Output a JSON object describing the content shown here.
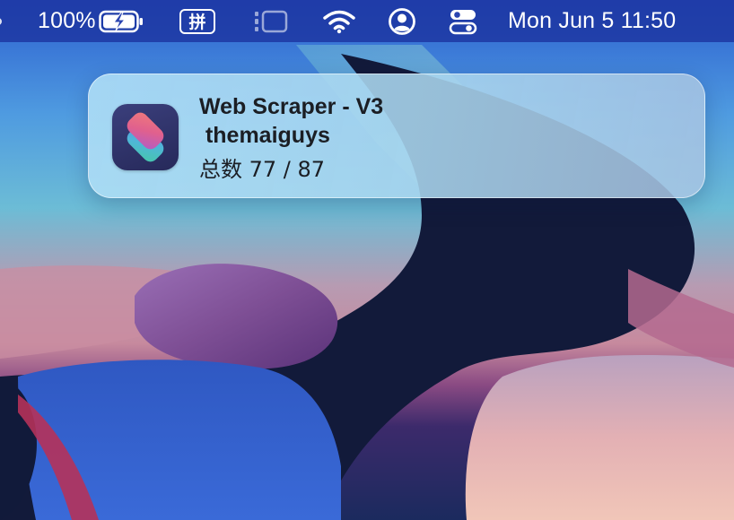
{
  "menubar": {
    "battery_percent": "100%",
    "input_method": "拼",
    "clock": "Mon Jun 5  11:50"
  },
  "notification": {
    "app": "Shortcuts",
    "title": "Web Scraper - V3",
    "subtitle": " themaiguys",
    "body": "总数 77 / 87"
  },
  "colors": {
    "menubar_bg": "#1c34a0",
    "notification_bg": "#aedef6",
    "text_dark": "#1b1e24"
  },
  "icons": {
    "battery": "battery-charging-icon",
    "input": "input-method-icon",
    "stage_manager": "stage-manager-icon",
    "wifi": "wifi-icon",
    "user": "user-account-icon",
    "control_center": "control-center-icon",
    "app": "shortcuts-app-icon"
  }
}
